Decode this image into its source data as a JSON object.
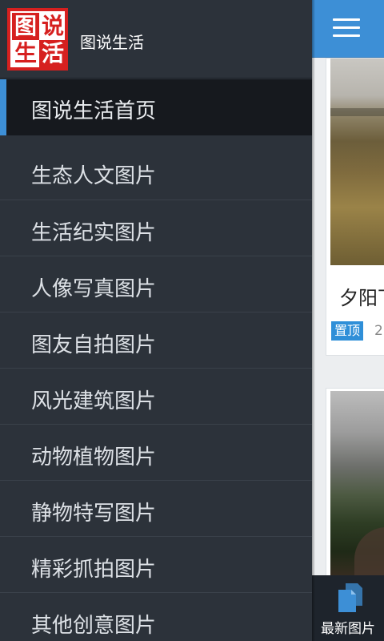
{
  "site": {
    "name": "图说生活",
    "logo_chars": [
      "图",
      "说",
      "生",
      "活"
    ]
  },
  "drawer": {
    "home_label": "图说生活首页",
    "items": [
      {
        "label": "生态人文图片"
      },
      {
        "label": "生活纪实图片"
      },
      {
        "label": "人像写真图片"
      },
      {
        "label": "图友自拍图片"
      },
      {
        "label": "风光建筑图片"
      },
      {
        "label": "动物植物图片"
      },
      {
        "label": "静物特写图片"
      },
      {
        "label": "精彩抓拍图片"
      },
      {
        "label": "其他创意图片"
      }
    ]
  },
  "main": {
    "menu_icon": "hamburger-menu-icon",
    "cards": [
      {
        "title": "夕阳下",
        "tag": "置顶",
        "date": "2"
      },
      {
        "title": "",
        "tag": "",
        "date": ""
      }
    ],
    "bottom_tab": {
      "label": "最新图片",
      "icon": "documents-icon"
    }
  },
  "colors": {
    "accent": "#3d8fd6",
    "drawer_bg": "#2c323a",
    "active_bg": "#16191e",
    "logo_red": "#d6201f",
    "pin_tag": "#2f8fd8"
  }
}
